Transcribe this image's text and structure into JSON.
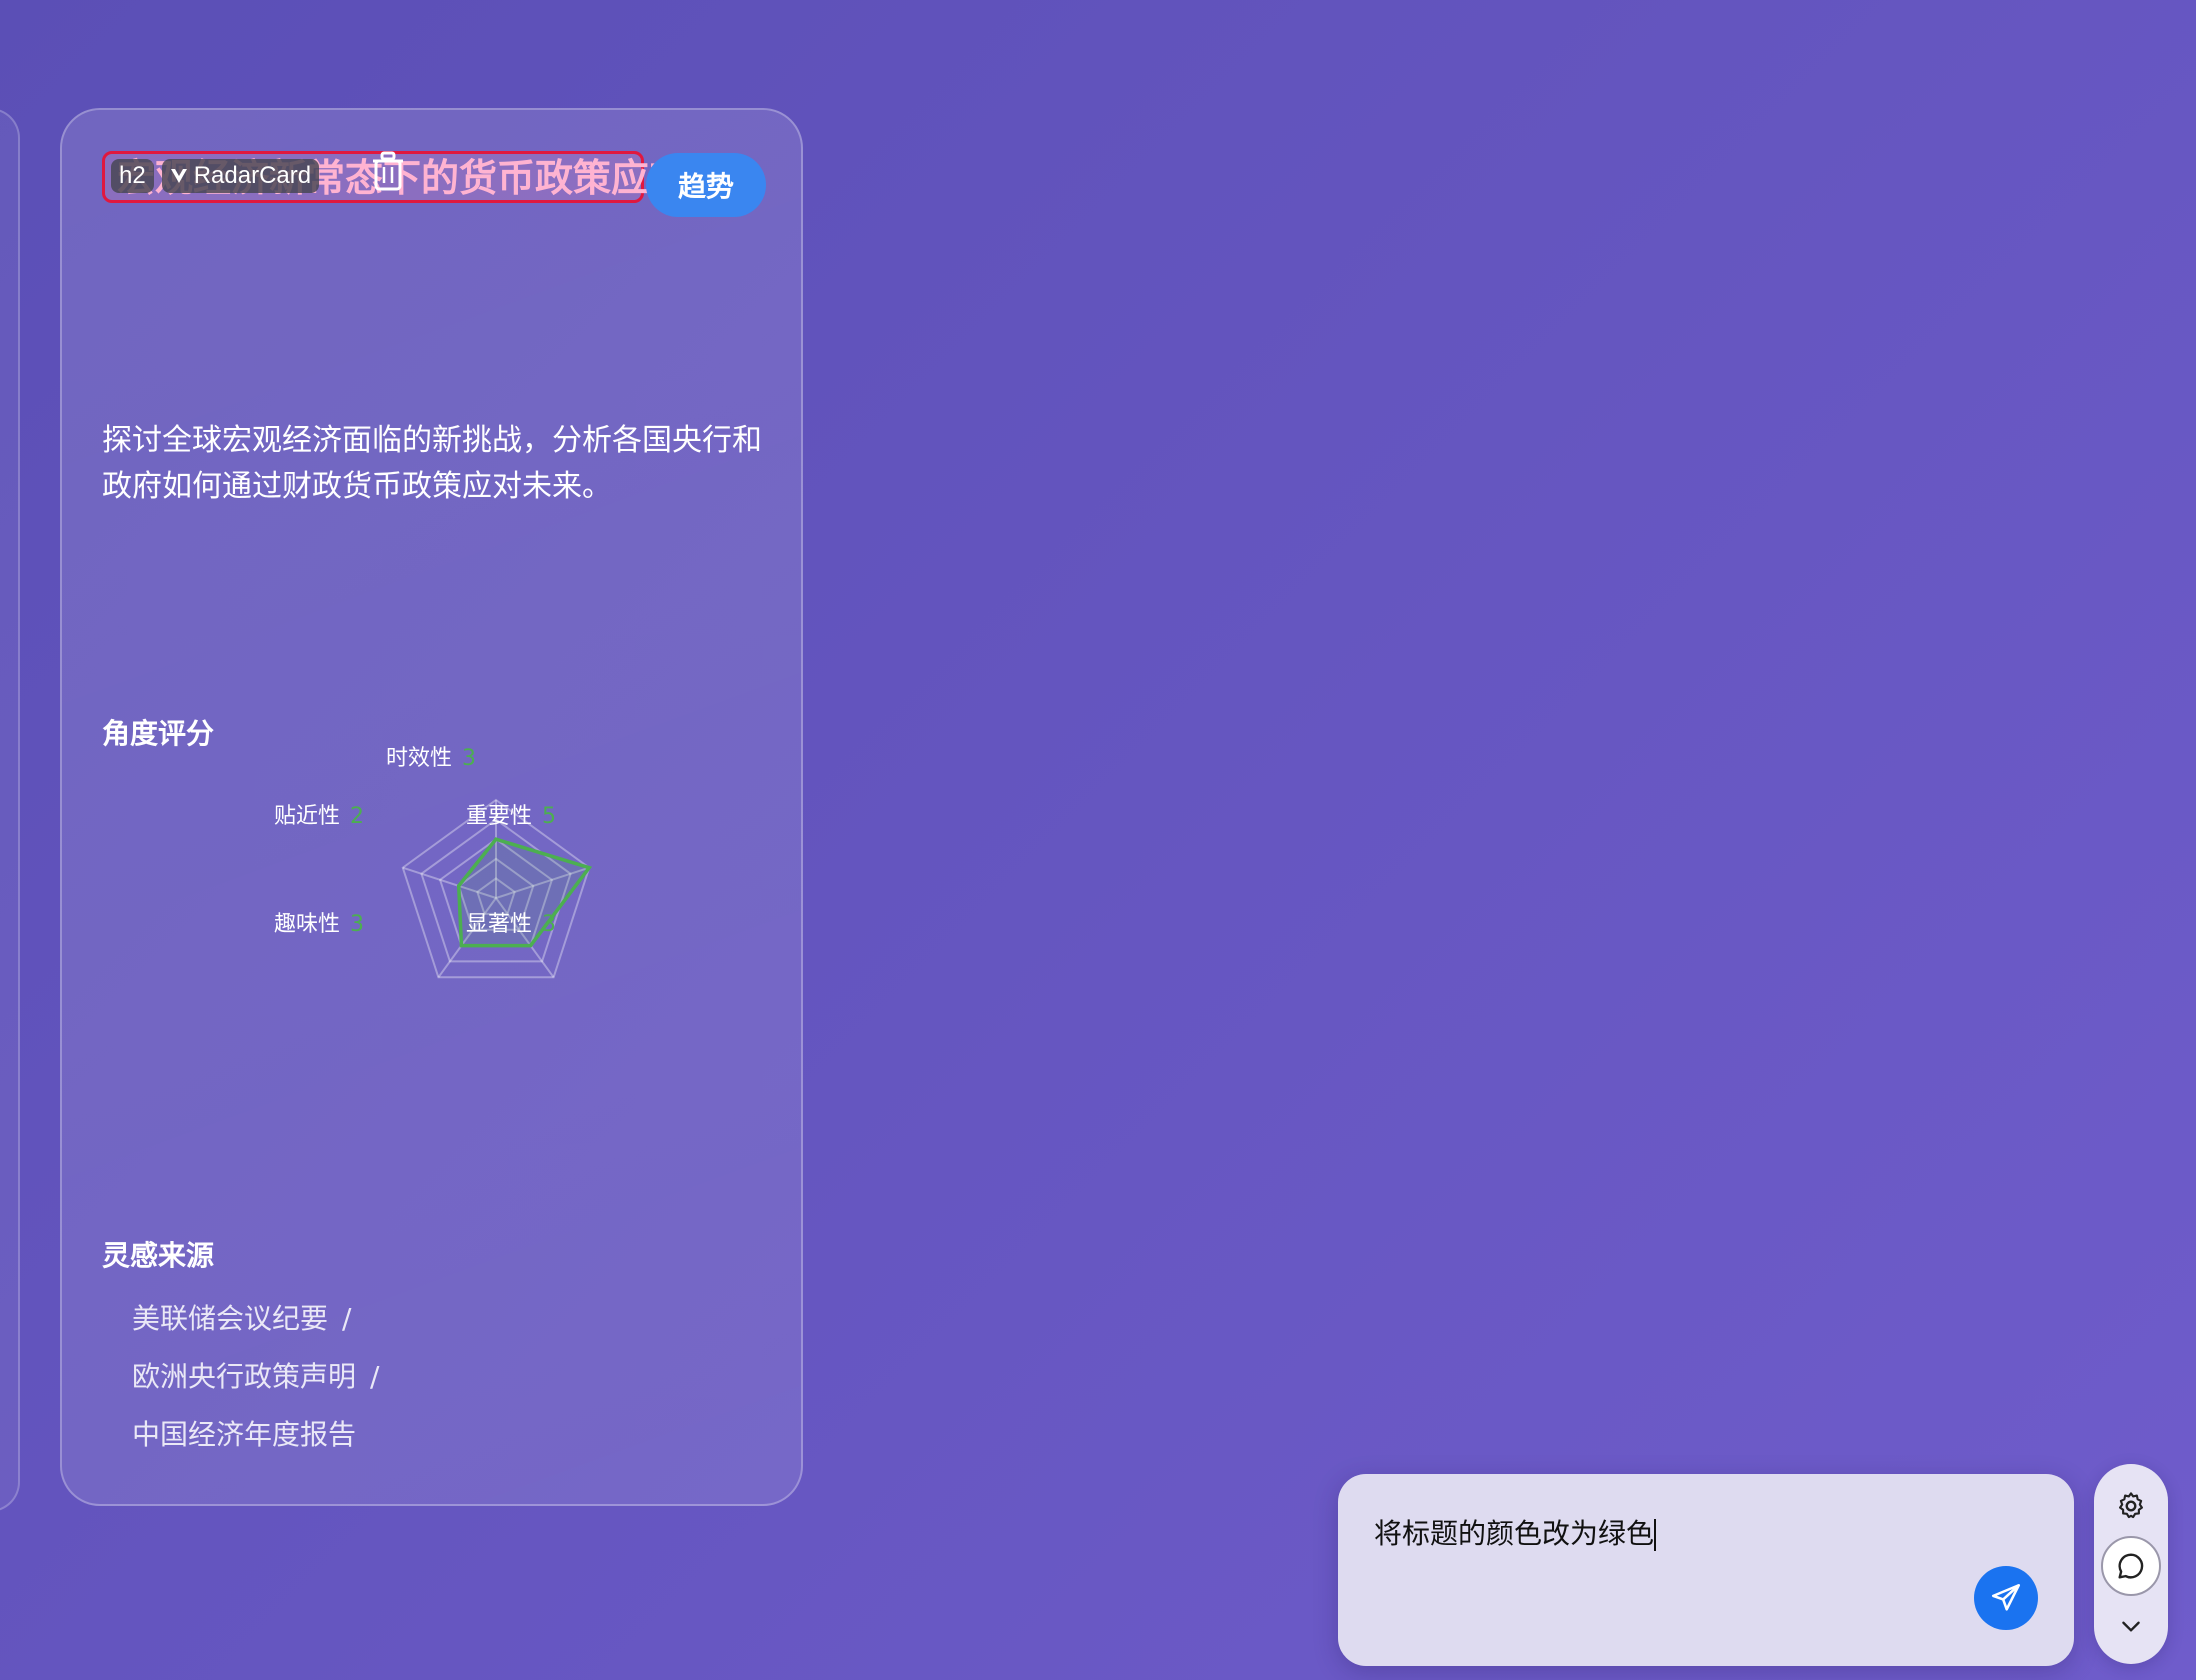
{
  "card": {
    "title": "宏观经济新常态下的货币政策应对",
    "component_tag": "h2",
    "component_name": "RadarCard",
    "trend_button": "趋势",
    "description": "探讨全球宏观经济面临的新挑战，分析各国央行和政府如何通过财政货币政策应对未来。",
    "radar_section_title": "角度评分",
    "radar": {
      "axes": [
        {
          "label": "时效性",
          "score": 3
        },
        {
          "label": "重要性",
          "score": 5
        },
        {
          "label": "显著性",
          "score": 3
        },
        {
          "label": "趣味性",
          "score": 3
        },
        {
          "label": "贴近性",
          "score": 2
        }
      ],
      "max": 5,
      "line_color": "#4caf50"
    },
    "sources_section_title": "灵感来源",
    "sources": [
      {
        "name": "美联储会议纪要",
        "sep": "/"
      },
      {
        "name": "欧洲央行政策声明",
        "sep": "/"
      },
      {
        "name": "中国经济年度报告",
        "sep": ""
      }
    ]
  },
  "chat": {
    "input_value": "将标题的颜色改为绿色",
    "send_icon": "send-icon"
  },
  "toolbar": {
    "icons": [
      "gear-icon",
      "chat-bubble-icon",
      "chevron-down-icon"
    ]
  },
  "colors": {
    "background": "#6455bf",
    "accent": "#3a86f0",
    "highlight_border": "#e0183f",
    "title": "#ffb3d1"
  }
}
